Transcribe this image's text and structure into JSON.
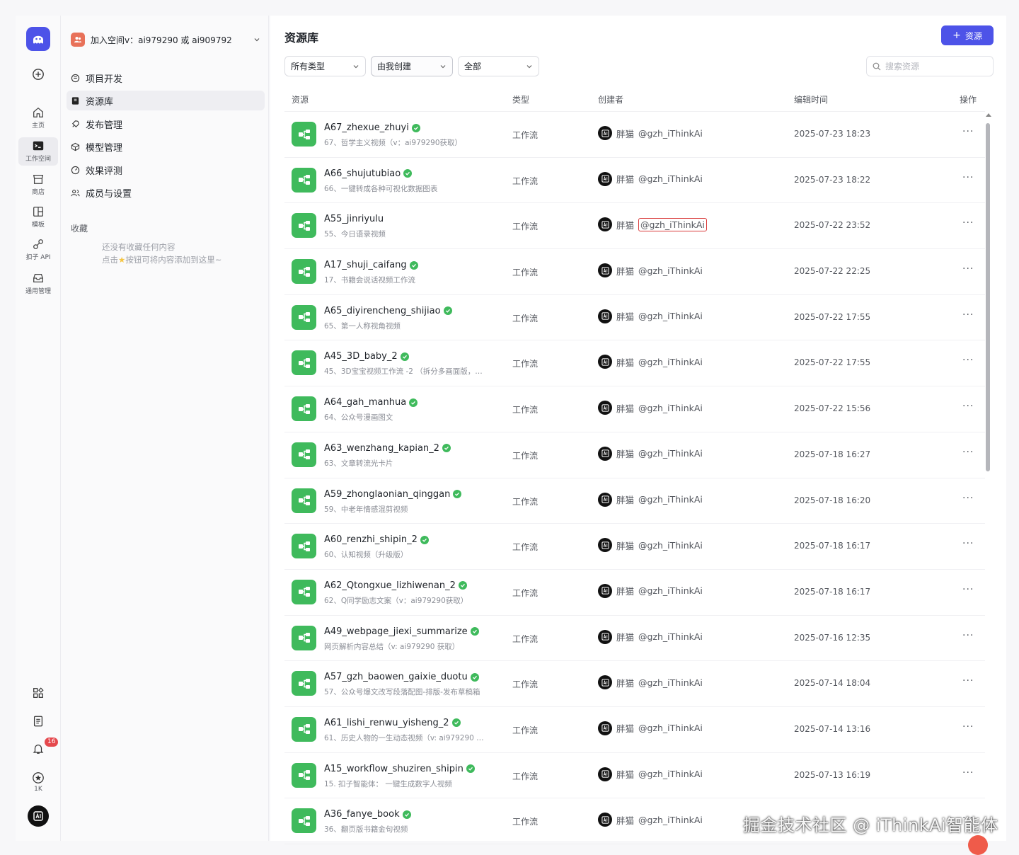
{
  "rail": {
    "items": [
      {
        "label": "主页",
        "icon": "home-icon"
      },
      {
        "label": "工作空间",
        "icon": "terminal-icon"
      },
      {
        "label": "商店",
        "icon": "store-icon"
      },
      {
        "label": "模板",
        "icon": "template-icon"
      },
      {
        "label": "扣子 API",
        "icon": "api-link-icon"
      },
      {
        "label": "通用管理",
        "icon": "inbox-icon"
      }
    ],
    "notification_count": "16",
    "star_count": "1K"
  },
  "sidebar": {
    "space_name": "加入空间v：ai979290 或 ai909792",
    "nav": [
      {
        "label": "项目开发",
        "icon": "project-icon"
      },
      {
        "label": "资源库",
        "icon": "library-icon"
      },
      {
        "label": "发布管理",
        "icon": "rocket-icon"
      },
      {
        "label": "模型管理",
        "icon": "cube-icon"
      },
      {
        "label": "效果评测",
        "icon": "gauge-icon"
      },
      {
        "label": "成员与设置",
        "icon": "users-icon"
      }
    ],
    "favorites_title": "收藏",
    "favorites_empty_line1": "还没有收藏任何内容",
    "favorites_empty_line2": "点击",
    "favorites_empty_line3": "按钮可将内容添加到这里~"
  },
  "main": {
    "title": "资源库",
    "add_button": "资源",
    "filters": [
      "所有类型",
      "由我创建",
      "全部"
    ],
    "search_placeholder": "搜索资源",
    "columns": {
      "resource": "资源",
      "type": "类型",
      "creator": "创建者",
      "edited": "编辑时间",
      "ops": "操作"
    }
  },
  "rows": [
    {
      "name": "A67_zhexue_zhuyi",
      "desc": "67、哲学主义视频（v：ai979290获取）",
      "type": "工作流",
      "creator": "胖猫",
      "handle": "@gzh_iThinkAi",
      "time": "2025-07-23 18:23"
    },
    {
      "name": "A66_shujutubiao",
      "desc": "66、一键转成各种可视化数据图表",
      "type": "工作流",
      "creator": "胖猫",
      "handle": "@gzh_iThinkAi",
      "time": "2025-07-23 18:22"
    },
    {
      "name": "A55_jinriyulu",
      "desc": "55、今日语录视频",
      "type": "工作流",
      "creator": "胖猫",
      "handle": "@gzh_iThinkAi",
      "time": "2025-07-22 23:52",
      "highlight": true,
      "verified": false
    },
    {
      "name": "A17_shuji_caifang",
      "desc": "17、书籍会说话视频工作流",
      "type": "工作流",
      "creator": "胖猫",
      "handle": "@gzh_iThinkAi",
      "time": "2025-07-22 22:25"
    },
    {
      "name": "A65_diyirencheng_shijiao",
      "desc": "65、第一人称视角视频",
      "type": "工作流",
      "creator": "胖猫",
      "handle": "@gzh_iThinkAi",
      "time": "2025-07-22 17:55"
    },
    {
      "name": "A45_3D_baby_2",
      "desc": "45、3D宝宝视频工作流 -2 （拆分多画面版，…",
      "type": "工作流",
      "creator": "胖猫",
      "handle": "@gzh_iThinkAi",
      "time": "2025-07-22 17:55"
    },
    {
      "name": "A64_gah_manhua",
      "desc": "64、公众号漫画图文",
      "type": "工作流",
      "creator": "胖猫",
      "handle": "@gzh_iThinkAi",
      "time": "2025-07-22 15:56"
    },
    {
      "name": "A63_wenzhang_kapian_2",
      "desc": "63、文章转流光卡片",
      "type": "工作流",
      "creator": "胖猫",
      "handle": "@gzh_iThinkAi",
      "time": "2025-07-18 16:27"
    },
    {
      "name": "A59_zhonglaonian_qinggan",
      "desc": "59、中老年情感混剪视频",
      "type": "工作流",
      "creator": "胖猫",
      "handle": "@gzh_iThinkAi",
      "time": "2025-07-18 16:20"
    },
    {
      "name": "A60_renzhi_shipin_2",
      "desc": "60、认知视频（升级版）",
      "type": "工作流",
      "creator": "胖猫",
      "handle": "@gzh_iThinkAi",
      "time": "2025-07-18 16:17"
    },
    {
      "name": "A62_Qtongxue_lizhiwenan_2",
      "desc": "62、Q同学励志文案（v：ai979290获取）",
      "type": "工作流",
      "creator": "胖猫",
      "handle": "@gzh_iThinkAi",
      "time": "2025-07-18 16:17"
    },
    {
      "name": "A49_webpage_jiexi_summarize",
      "desc": "网页解析内容总结（v: ai979290 获取）",
      "type": "工作流",
      "creator": "胖猫",
      "handle": "@gzh_iThinkAi",
      "time": "2025-07-16 12:35"
    },
    {
      "name": "A57_gzh_baowen_gaixie_duotu",
      "desc": "57、公众号爆文改写段落配图-排版-发布草稿箱",
      "type": "工作流",
      "creator": "胖猫",
      "handle": "@gzh_iThinkAi",
      "time": "2025-07-14 18:04"
    },
    {
      "name": "A61_lishi_renwu_yisheng_2",
      "desc": "61、历史人物的一生动态视频（v: ai979290 …",
      "type": "工作流",
      "creator": "胖猫",
      "handle": "@gzh_iThinkAi",
      "time": "2025-07-14 13:16"
    },
    {
      "name": "A15_workflow_shuziren_shipin",
      "desc": "15. 扣子智能体： 一键生成数字人视频",
      "type": "工作流",
      "creator": "胖猫",
      "handle": "@gzh_iThinkAi",
      "time": "2025-07-13 16:19"
    },
    {
      "name": "A36_fanye_book",
      "desc": "36、翻页版书籍金句视频",
      "type": "工作流",
      "creator": "胖猫",
      "handle": "@gzh_iThinkAi",
      "time": ""
    }
  ],
  "watermark": "掘金技术社区 @ iThinkAi智能体",
  "colors": {
    "accent": "#4d53e8",
    "workflow_green": "#3fba5c",
    "highlight_red": "#d93a3a"
  }
}
